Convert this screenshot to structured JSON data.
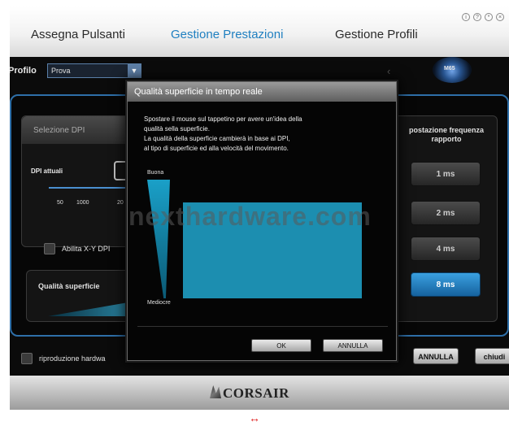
{
  "tabs": [
    "Assegna Pulsanti",
    "Gestione Prestazioni",
    "Gestione Profili"
  ],
  "window_controls": [
    "info-icon",
    "help-icon",
    "settings-icon",
    "close-icon"
  ],
  "profile": {
    "label": "Profilo",
    "value": "Prova"
  },
  "dpi_panel": {
    "title": "Selezione DPI",
    "current_label": "DPI attuali",
    "ticks": [
      "50",
      "1000",
      "20"
    ],
    "xy_label": "Abilita X-Y DPI"
  },
  "surface_panel": {
    "label": "Qualità superficie"
  },
  "freq_panel": {
    "title": "postazione frequenza rapporto",
    "options": [
      "1 ms",
      "2 ms",
      "4 ms",
      "8 ms"
    ],
    "selected": "8 ms"
  },
  "main": {
    "hw_label": "riproduzione hardwa",
    "annulla_label": "ANNULLA",
    "chiudi_label": "chiudi"
  },
  "footer": {
    "brand": "CORSAIR"
  },
  "modal": {
    "title": "Qualità superficie in tempo reale",
    "description_lines": [
      "Spostare il mouse sul tappetino per avere un'idea della",
      "qualità sella superficie.",
      "La qualità della superficie cambierà in base ai DPI,",
      "al tipo di superficie ed alla velocità del movimento."
    ],
    "gauge_top": "Buona",
    "gauge_bottom": "Mediocre",
    "ok_label": "OK",
    "annulla_label": "ANNULLA"
  },
  "watermark": "nexthardware.com",
  "expand_glyph": "↔",
  "colors": {
    "accent": "#1f7fc0",
    "selected_button": "#2a8fd6",
    "surface_pad": "#1c8eb0"
  }
}
